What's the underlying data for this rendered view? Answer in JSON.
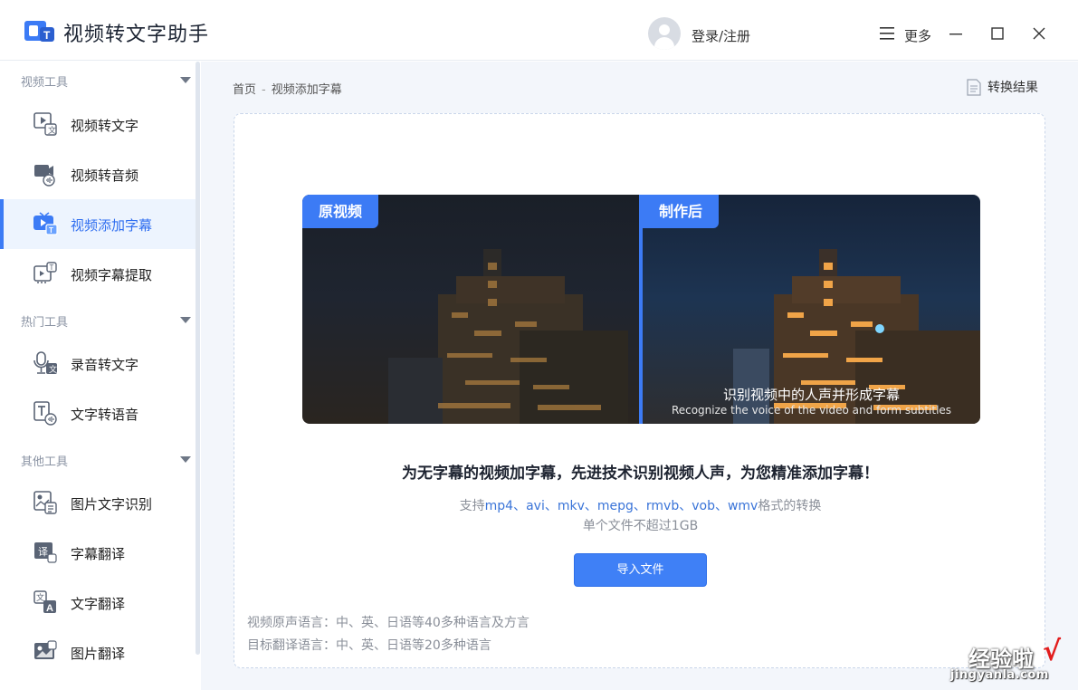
{
  "app": {
    "title": "视频转文字助手",
    "login_label": "登录/注册",
    "more_label": "更多"
  },
  "sidebar": {
    "groups": [
      {
        "label": "视频工具",
        "items": [
          {
            "label": "视频转文字",
            "icon": "video-to-text-icon"
          },
          {
            "label": "视频转音频",
            "icon": "video-to-audio-icon"
          },
          {
            "label": "视频添加字幕",
            "icon": "video-subtitle-icon",
            "active": true
          },
          {
            "label": "视频字幕提取",
            "icon": "subtitle-extract-icon"
          }
        ]
      },
      {
        "label": "热门工具",
        "items": [
          {
            "label": "录音转文字",
            "icon": "mic-to-text-icon"
          },
          {
            "label": "文字转语音",
            "icon": "text-to-speech-icon"
          }
        ]
      },
      {
        "label": "其他工具",
        "items": [
          {
            "label": "图片文字识别",
            "icon": "image-ocr-icon"
          },
          {
            "label": "字幕翻译",
            "icon": "subtitle-translate-icon"
          },
          {
            "label": "文字翻译",
            "icon": "text-translate-icon"
          },
          {
            "label": "图片翻译",
            "icon": "image-translate-icon"
          }
        ]
      }
    ]
  },
  "breadcrumb": {
    "home": "首页",
    "sep": "-",
    "current": "视频添加字幕"
  },
  "result_button": "转换结果",
  "preview": {
    "before_tag": "原视频",
    "after_tag": "制作后",
    "caption_cn": "识别视频中的人声并形成字幕",
    "caption_en": "Recognize the voice of the video and form subtitles"
  },
  "headline": "为无字幕的视频加字幕，先进技术识别视频人声，为您精准添加字幕！",
  "formats": {
    "prefix": "支持",
    "list": "mp4、avi、mkv、mepg、rmvb、vob、wmv",
    "suffix": "格式的转换"
  },
  "limit": "单个文件不超过1GB",
  "import_button": "导入文件",
  "languages": {
    "source": "视频原声语言：中、英、日语等40多种语言及方言",
    "target": "目标翻译语言：中、英、日语等20多种语言"
  },
  "watermark": {
    "cn": "经验啦",
    "en": "jingyanla.com",
    "check": "√"
  },
  "colors": {
    "accent": "#3c7bf5",
    "active_bg": "#edf4fe",
    "main_bg": "#f3f6fb"
  }
}
